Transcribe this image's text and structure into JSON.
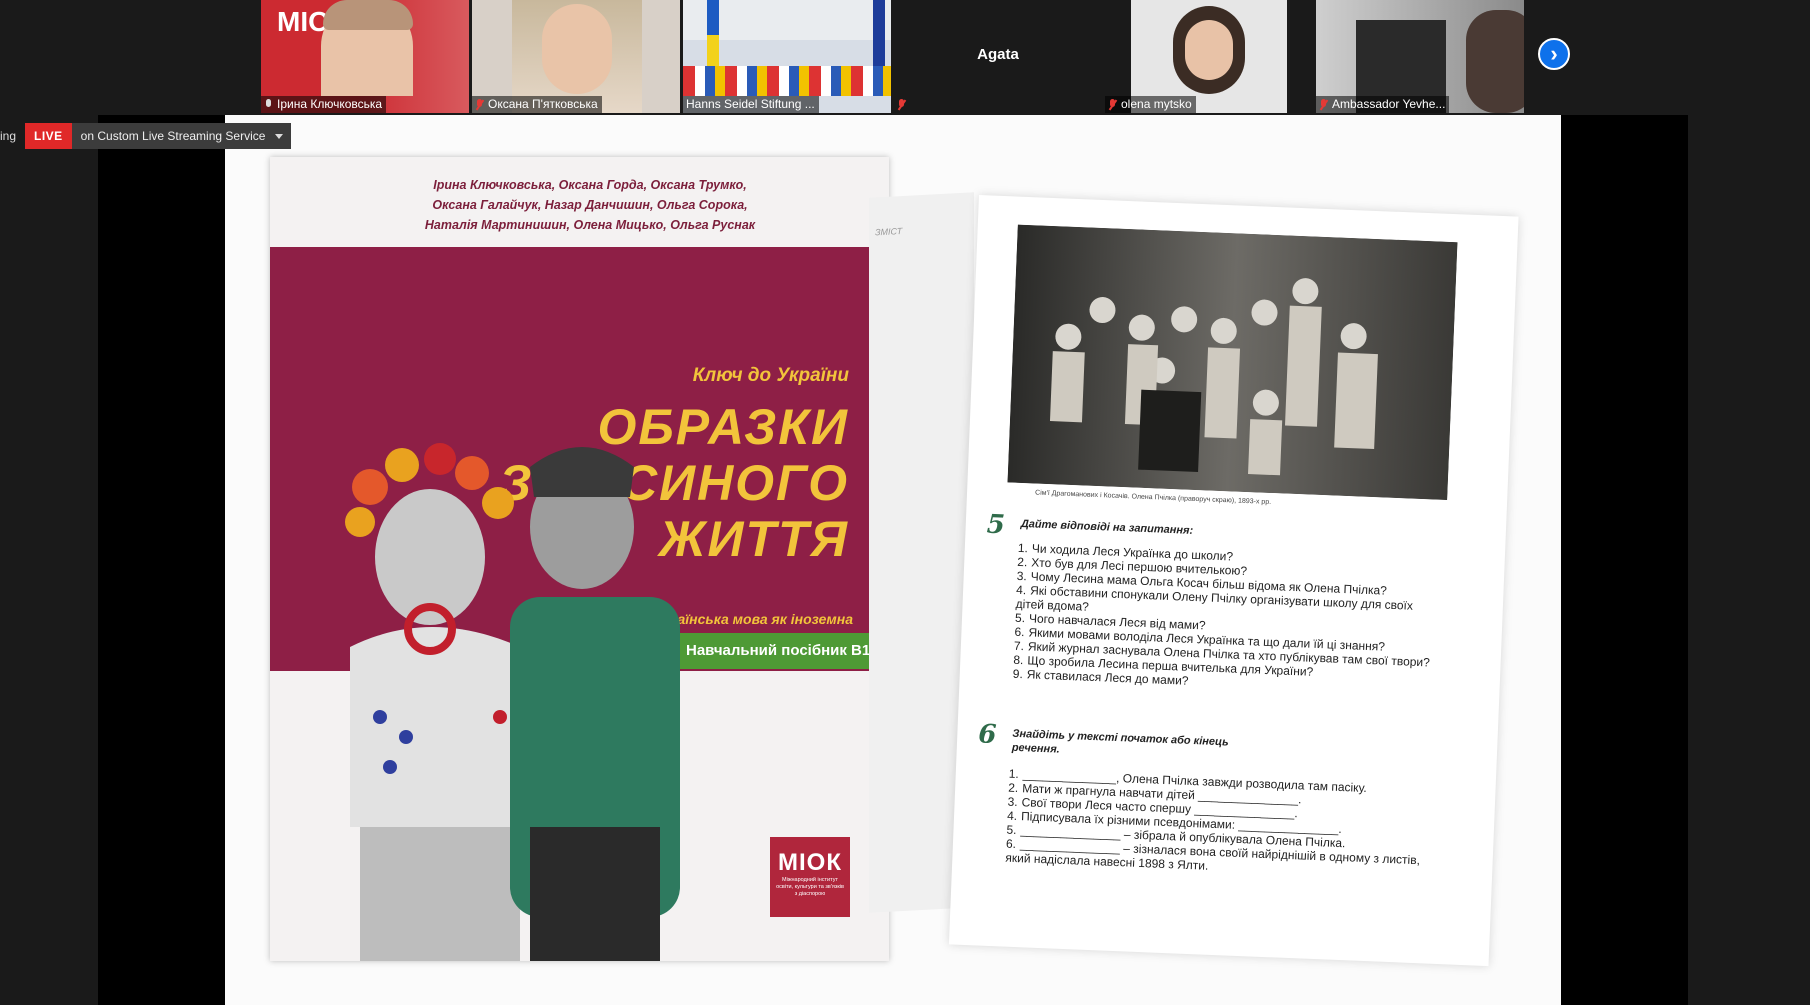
{
  "participants": [
    {
      "name": "Ірина Ключковська",
      "muted": false,
      "kind": "video"
    },
    {
      "name": "Оксана П'ятковська",
      "muted": true,
      "kind": "video"
    },
    {
      "name": "Hanns Seidel Stiftung ...",
      "muted": false,
      "kind": "video"
    },
    {
      "name": "Agata",
      "muted": true,
      "kind": "name-only"
    },
    {
      "name": "olena mytsko",
      "muted": true,
      "kind": "video"
    },
    {
      "name": "Ambassador Yevhe...",
      "muted": true,
      "kind": "video"
    }
  ],
  "live": {
    "left_text": "ing",
    "badge": "LIVE",
    "status": "on Custom Live Streaming Service"
  },
  "cover": {
    "authors": [
      "Ірина Ключковська, Оксана Горда, Оксана Трумко,",
      "Оксана Галайчук, Назар Данчишин, Ольга Сорока,",
      "Наталія Мартинишин, Олена Мицько, Ольга Руснак"
    ],
    "series": "Ключ до України",
    "title": [
      "ОБРАЗКИ",
      "З ЛЕСИНОГО",
      "ЖИТТЯ"
    ],
    "subtitle": "Українська мова як іноземна",
    "level": "Навчальний посібник В1",
    "logo": "МІОК",
    "logo_small": "Міжнародний інститут освіти, культури та зв'язків з діаспорою"
  },
  "page": {
    "left_tab": "ЗМІСТ",
    "caption": "Сім'ї Драгоманових і Косачів. Олена Пчілка (праворуч скраю), 1893-х рр.",
    "ex5": {
      "num": "5",
      "title": "Дайте відповіді на запитання:",
      "items": [
        "Чи ходила Леся Українка до школи?",
        "Хто був для Лесі першою вчителькою?",
        "Чому Лесина мама Ольга Косач більш відома як Олена Пчілка?",
        "Які обставини спонукали Олену Пчілку організувати школу для своїх дітей вдома?",
        "Чого навчалася Леся від мами?",
        "Якими мовами володіла Леся Українка та що дали їй ці знання?",
        "Який журнал заснувала Олена Пчілка та хто публікував там свої твори?",
        "Що зробила Лесина перша вчителька для України?",
        "Як ставилася Леся до мами?"
      ]
    },
    "ex6": {
      "num": "6",
      "title": "Знайдіть у тексті початок або кінець речення.",
      "items": [
        "______________, Олена Пчілка завжди розводила там пасіку.",
        "Мати ж прагнула навчати дітей _______________.",
        "Свої твори Леся часто спершу _______________.",
        "Підписувала їх різними псевдонімами: _______________.",
        "_______________ – зібрала й опублікувала Олена Пчілка.",
        "_______________ – зізналася вона своїй найріднішій в одному з листів, який надіслала навесні 1898 з Ялти."
      ]
    }
  }
}
